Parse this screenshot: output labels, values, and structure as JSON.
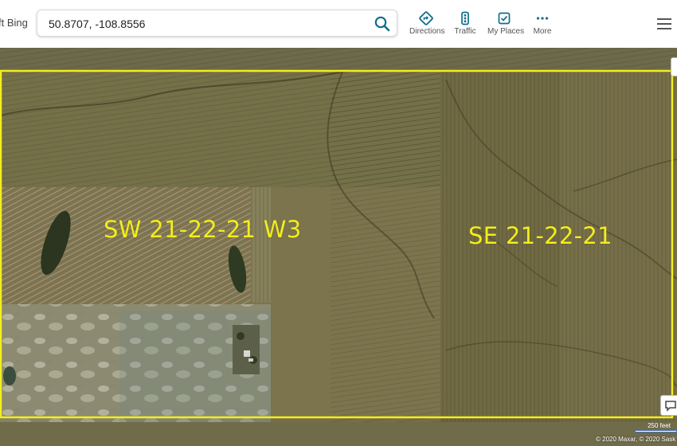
{
  "topbar": {
    "brand_text": "ft Bing",
    "search": {
      "value": "50.8707, -108.8556",
      "button_icon": "search-icon"
    },
    "nav": [
      {
        "label": "Directions",
        "icon": "directions-icon"
      },
      {
        "label": "Traffic",
        "icon": "traffic-icon"
      },
      {
        "label": "My Places",
        "icon": "my-places-icon"
      },
      {
        "label": "More",
        "icon": "more-icon"
      }
    ],
    "menu_icon": "hamburger-menu-icon"
  },
  "map": {
    "view": "aerial",
    "parcels": [
      {
        "label": "SW 21-22-21 W3"
      },
      {
        "label": "SE 21-22-21"
      }
    ],
    "boundary_color": "#f3ee1c",
    "scale_text": "250 feet",
    "copyright": "© 2020 Maxar, © 2020 Sask"
  },
  "colors": {
    "accent": "#0f6e8c",
    "parcel_label": "#f3ee1c",
    "field": "#7a7451"
  }
}
